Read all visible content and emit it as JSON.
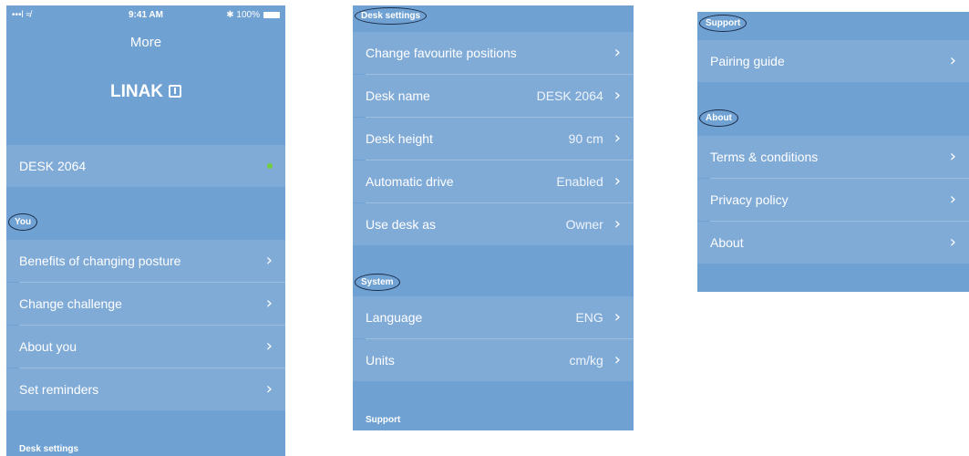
{
  "screen1": {
    "status": {
      "signal": "•••l ≉",
      "time": "9:41 AM",
      "battery": "✱ 100%"
    },
    "title": "More",
    "logo": "LINAK",
    "device": {
      "name": "DESK 2064",
      "status_color": "#6fcf3a"
    },
    "you_header": "You",
    "you_items": [
      {
        "label": "Benefits of changing posture"
      },
      {
        "label": "Change challenge"
      },
      {
        "label": "About you"
      },
      {
        "label": "Set reminders"
      }
    ],
    "desk_settings_header": "Desk settings"
  },
  "screen2": {
    "desk_settings_header": "Desk settings",
    "desk_items": [
      {
        "label": "Change favourite positions",
        "value": ""
      },
      {
        "label": "Desk name",
        "value": "DESK 2064"
      },
      {
        "label": "Desk height",
        "value": "90 cm"
      },
      {
        "label": "Automatic drive",
        "value": "Enabled"
      },
      {
        "label": "Use desk as",
        "value": "Owner"
      }
    ],
    "system_header": "System",
    "system_items": [
      {
        "label": "Language",
        "value": "ENG"
      },
      {
        "label": "Units",
        "value": "cm/kg"
      }
    ],
    "support_header": "Support"
  },
  "screen3": {
    "support_header": "Support",
    "support_items": [
      {
        "label": "Pairing guide"
      }
    ],
    "about_header": "About",
    "about_items": [
      {
        "label": "Terms & conditions"
      },
      {
        "label": "Privacy policy"
      },
      {
        "label": "About"
      }
    ]
  },
  "icons": {
    "chevron": "chevron-right-icon"
  },
  "colors": {
    "panel_bg": "#6fa1d2",
    "row_bg": "#80abd7",
    "highlight_circle": "#1b2b4a"
  }
}
